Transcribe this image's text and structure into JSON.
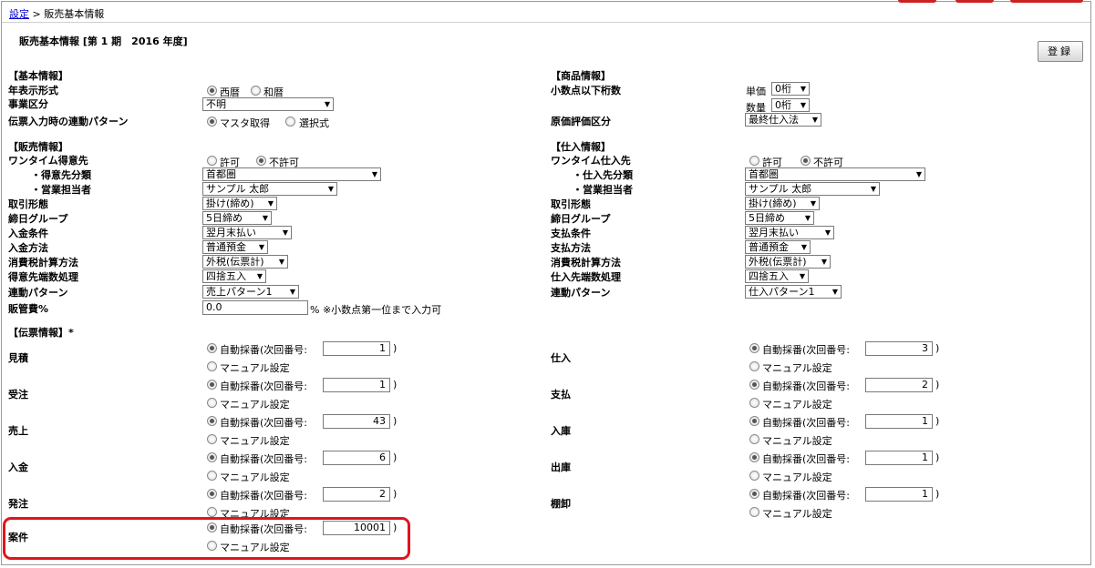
{
  "breadcrumb": {
    "link": "設定",
    "sep": " > ",
    "current": "販売基本情報"
  },
  "page_title": "販売基本情報 [第 1 期　2016 年度]",
  "register_button": "登録",
  "basic": {
    "heading": "【基本情報】",
    "year_format_label": "年表示形式",
    "year_options": [
      "西暦",
      "和暦"
    ],
    "year_selected": "西暦",
    "business_label": "事業区分",
    "business_value": "不明",
    "link_pattern_label": "伝票入力時の連動パターン",
    "link_options": [
      "マスタ取得",
      "選択式"
    ],
    "link_selected": "マスタ取得"
  },
  "product": {
    "heading": "【商品情報】",
    "decimal_label": "小数点以下桁数",
    "unit_price_label": "単価",
    "unit_price_value": "0桁",
    "quantity_label": "数量",
    "quantity_value": "0桁",
    "cost_label": "原価評価区分",
    "cost_value": "最終仕入法"
  },
  "sales": {
    "heading": "【販売情報】",
    "onetime_label": "ワンタイム得意先",
    "onetime_options": [
      "許可",
      "不許可"
    ],
    "onetime_selected": "不許可",
    "class_label": "・得意先分類",
    "class_value": "首都圏",
    "staff_label": "・営業担当者",
    "staff_value": "サンプル 太郎",
    "trade_label": "取引形態",
    "trade_value": "掛け(締め)",
    "closing_label": "締日グループ",
    "closing_value": "5日締め",
    "cond_label": "入金条件",
    "cond_value": "翌月末払い",
    "method_label": "入金方法",
    "method_value": "普通預金",
    "tax_label": "消費税計算方法",
    "tax_value": "外税(伝票計)",
    "round_label": "得意先端数処理",
    "round_value": "四捨五入",
    "pattern_label": "連動パターン",
    "pattern_value": "売上パターン1",
    "margin_label": "販管費%",
    "margin_value": "0.0",
    "margin_note": "% ※小数点第一位まで入力可"
  },
  "purchase": {
    "heading": "【仕入情報】",
    "onetime_label": "ワンタイム仕入先",
    "onetime_options": [
      "許可",
      "不許可"
    ],
    "onetime_selected": "不許可",
    "class_label": "・仕入先分類",
    "class_value": "首都圏",
    "staff_label": "・営業担当者",
    "staff_value": "サンプル 太郎",
    "trade_label": "取引形態",
    "trade_value": "掛け(締め)",
    "closing_label": "締日グループ",
    "closing_value": "5日締め",
    "cond_label": "支払条件",
    "cond_value": "翌月末払い",
    "method_label": "支払方法",
    "method_value": "普通預金",
    "tax_label": "消費税計算方法",
    "tax_value": "外税(伝票計)",
    "round_label": "仕入先端数処理",
    "round_value": "四捨五入",
    "pattern_label": "連動パターン",
    "pattern_value": "仕入パターン1"
  },
  "slips": {
    "heading": "【伝票情報】*",
    "auto_label": "自動採番(次回番号:",
    "close_paren": ")",
    "manual_label": "マニュアル設定",
    "left": [
      {
        "name": "見積",
        "next": "1"
      },
      {
        "name": "受注",
        "next": "1"
      },
      {
        "name": "売上",
        "next": "43"
      },
      {
        "name": "入金",
        "next": "6"
      },
      {
        "name": "発注",
        "next": "2"
      },
      {
        "name": "案件",
        "next": "10001"
      }
    ],
    "right": [
      {
        "name": "仕入",
        "next": "3"
      },
      {
        "name": "支払",
        "next": "2"
      },
      {
        "name": "入庫",
        "next": "1"
      },
      {
        "name": "出庫",
        "next": "1"
      },
      {
        "name": "棚卸",
        "next": "1"
      }
    ]
  }
}
